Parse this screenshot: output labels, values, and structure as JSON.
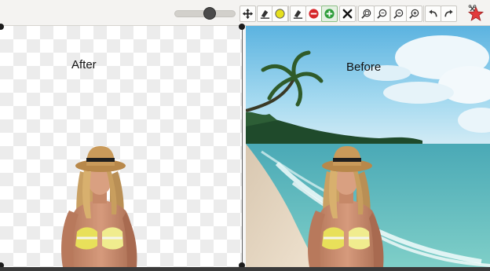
{
  "toolbar": {
    "zoom_slider_value": 0.6,
    "tools": [
      {
        "name": "move-tool",
        "icon": "move-arrows-icon"
      },
      {
        "name": "keep-brush-tool",
        "icon": "eraser-plus-icon"
      },
      {
        "name": "keep-color-tool",
        "icon": "yellow-circle-icon"
      },
      {
        "name": "remove-brush-tool",
        "icon": "eraser-minus-icon"
      },
      {
        "name": "remove-color-tool",
        "icon": "red-minus-circle-icon"
      },
      {
        "name": "add-color-tool",
        "icon": "green-plus-circle-icon",
        "active": true
      },
      {
        "name": "clear-tool",
        "icon": "x-icon"
      },
      {
        "name": "zoom-fit-tool",
        "icon": "zoom-fit-icon"
      },
      {
        "name": "zoom-actual-tool",
        "icon": "zoom-actual-icon"
      },
      {
        "name": "zoom-out-tool",
        "icon": "zoom-out-icon"
      },
      {
        "name": "zoom-in-tool",
        "icon": "zoom-in-icon"
      },
      {
        "name": "undo-tool",
        "icon": "undo-icon"
      },
      {
        "name": "redo-tool",
        "icon": "redo-icon"
      },
      {
        "name": "app-logo",
        "icon": "star-scissors-icon"
      }
    ]
  },
  "panels": {
    "after_label": "After",
    "before_label": "Before"
  },
  "colors": {
    "sky": "#7ec6e6",
    "sea": "#5bb7bc",
    "sand": "#e8d8c3",
    "add_green": "#2e9e3a",
    "remove_red": "#d6262a",
    "keep_yellow": "#e6e01e"
  }
}
